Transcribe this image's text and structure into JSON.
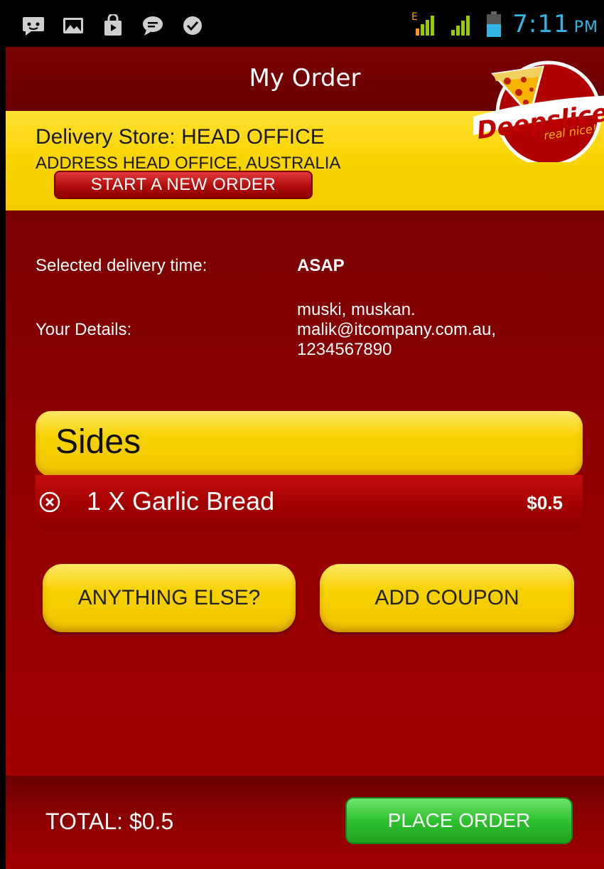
{
  "status_bar": {
    "time": "7:11",
    "ampm": "PM",
    "notification_icons": [
      "chat-icon",
      "image-icon",
      "shopping-bag-icon",
      "message-icon",
      "check-badge-icon"
    ],
    "network_label": "E",
    "accent": "#33b5e5"
  },
  "header": {
    "title": "My Order"
  },
  "brand": {
    "name": "Deepslice",
    "tagline": "real nice!"
  },
  "store": {
    "line1": "Delivery Store: HEAD OFFICE",
    "line2": "ADDRESS HEAD OFFICE, AUSTRALIA",
    "new_order_label": "START A NEW ORDER"
  },
  "order_info": {
    "delivery_time_label": "Selected delivery time:",
    "delivery_time_value": "ASAP",
    "details_label": "Your Details:",
    "details_lines": [
      "muski, muskan.",
      "malik@itcompany.com.au,",
      "1234567890"
    ]
  },
  "section": {
    "title": "Sides"
  },
  "items": [
    {
      "name": "1 X Garlic Bread",
      "price": "$0.5"
    }
  ],
  "actions": {
    "anything_else": "ANYTHING ELSE?",
    "add_coupon": "ADD COUPON"
  },
  "footer": {
    "total": "TOTAL: $0.5",
    "place_order": "PLACE ORDER"
  },
  "colors": {
    "dark_red": "#7a0000",
    "yellow": "#f6d200",
    "green": "#2fc12f"
  }
}
